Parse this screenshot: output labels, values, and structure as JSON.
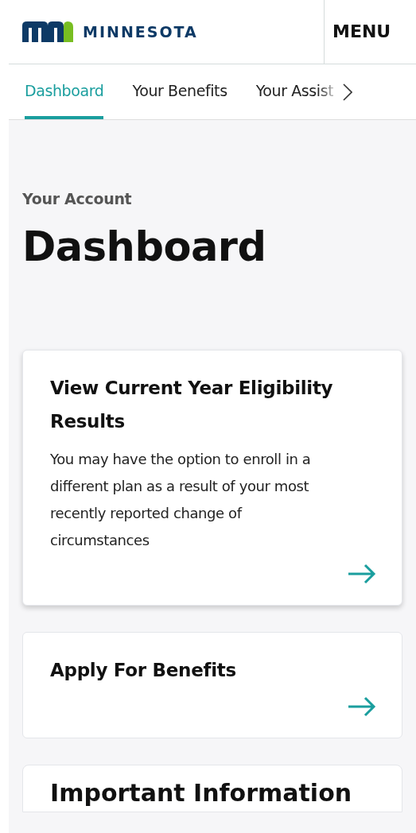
{
  "header": {
    "logo_text": "MINNESOTA",
    "menu": "MENU"
  },
  "tabs": [
    {
      "label": "Dashboard",
      "selected": true
    },
    {
      "label": "Your Benefits",
      "selected": false
    },
    {
      "label": "Your Assist",
      "selected": false
    }
  ],
  "breadcrumb": "Your Account",
  "title": "Dashboard",
  "cards": [
    {
      "title": "View Current Year Eligibility Results",
      "body": "You may have the option to enroll in a different plan as a result of your most recently reported change of circumstances",
      "elevated": true
    },
    {
      "title": "Apply For Benefits",
      "elevated": false
    }
  ],
  "partial_card": {
    "title": "Important Information"
  }
}
